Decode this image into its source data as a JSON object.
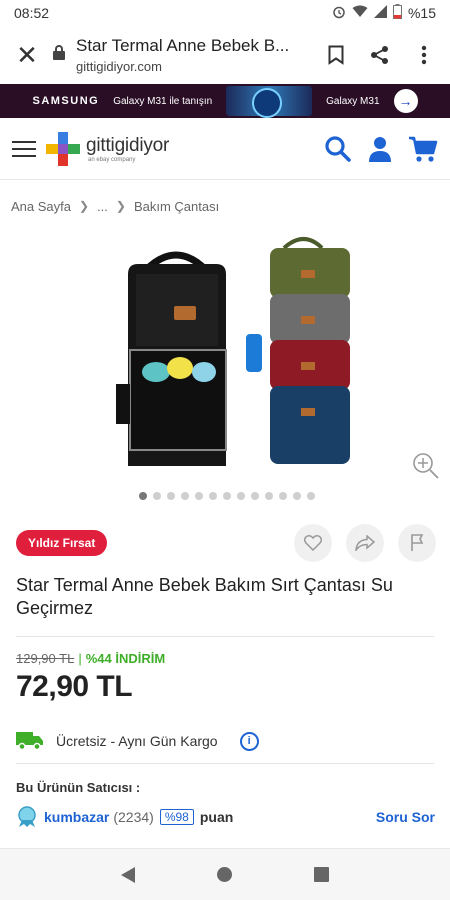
{
  "status_bar": {
    "time": "08:52",
    "battery": "%15"
  },
  "browser": {
    "title": "Star Termal Anne Bebek B...",
    "url": "gittigidiyor.com"
  },
  "ad": {
    "brand": "SAMSUNG",
    "text": "Galaxy M31 ile tanışın",
    "model": "Galaxy M31"
  },
  "site": {
    "logo_name": "gittigidiyor",
    "logo_sub": "an ebay company"
  },
  "breadcrumb": {
    "home": "Ana Sayfa",
    "ellipsis": "...",
    "current": "Bakım Çantası"
  },
  "gallery": {
    "dot_count": 13,
    "active_index": 0
  },
  "product": {
    "badge": "Yıldız Fırsat",
    "title": "Star Termal Anne Bebek Bakım Sırt Çantası Su Geçirmez",
    "old_price": "129,90 TL",
    "separator": "|",
    "discount": "%44 İNDİRİM",
    "price": "72,90 TL",
    "shipping": "Ücretsiz - Aynı Gün Kargo"
  },
  "seller": {
    "heading": "Bu Ürünün Satıcısı :",
    "name": "kumbazar",
    "count": "(2234)",
    "rating": "%98",
    "puan": "puan",
    "ask": "Soru Sor"
  },
  "colors": {
    "accent_blue": "#1e63d4",
    "badge_red": "#e01f3c",
    "discount_green": "#3fae29"
  }
}
